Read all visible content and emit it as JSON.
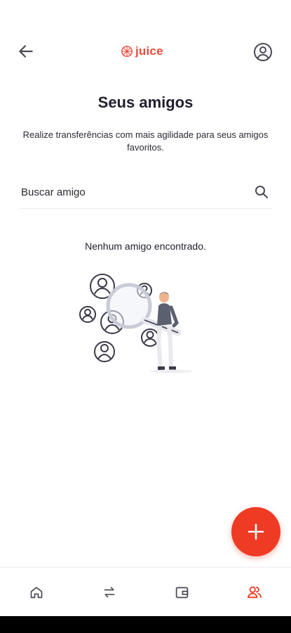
{
  "app": {
    "logo_text": "juice",
    "brand_color": "#ef3b24"
  },
  "header": {
    "back_icon": "arrow-left-icon",
    "profile_icon": "user-circle-icon"
  },
  "page": {
    "title": "Seus amigos",
    "subtitle": "Realize transferências com mais agilidade para seus amigos favoritos."
  },
  "search": {
    "placeholder": "Buscar amigo",
    "value": "",
    "icon": "search-icon"
  },
  "empty_state": {
    "message": "Nenhum amigo encontrado."
  },
  "fab": {
    "icon": "plus-icon"
  },
  "bottom_nav": {
    "items": [
      {
        "name": "home",
        "icon": "home-icon",
        "active": false
      },
      {
        "name": "transfers",
        "icon": "transfer-icon",
        "active": false
      },
      {
        "name": "wallet",
        "icon": "wallet-icon",
        "active": false
      },
      {
        "name": "friends",
        "icon": "friends-icon",
        "active": true
      }
    ],
    "active_color": "#ef3b24",
    "inactive_color": "#4a4a55"
  }
}
